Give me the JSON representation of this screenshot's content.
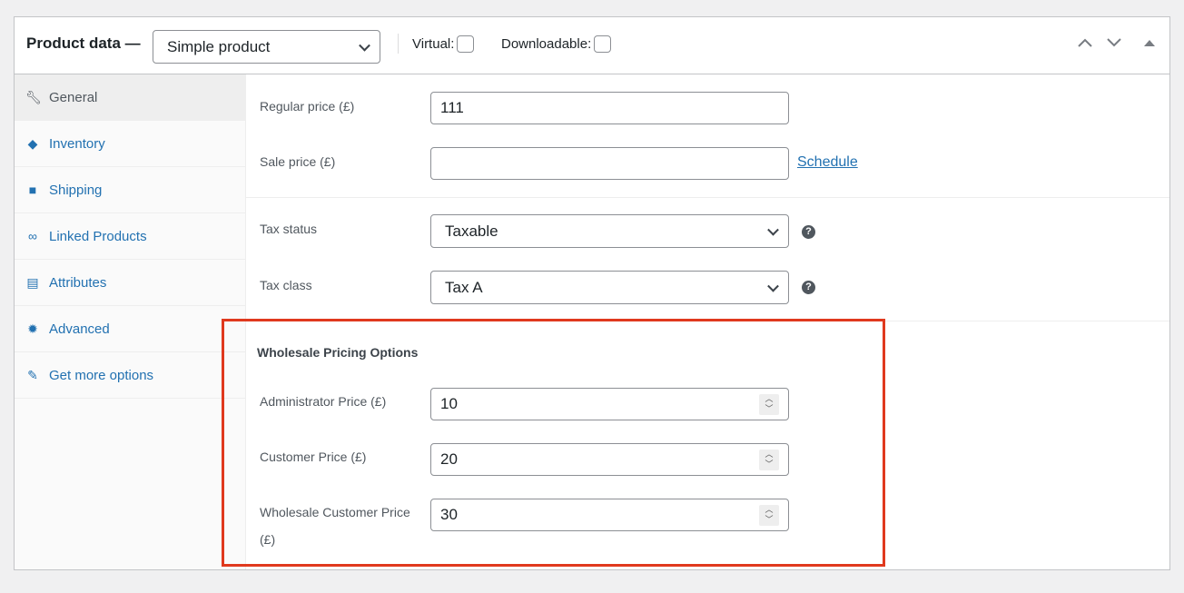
{
  "header": {
    "title": "Product data —",
    "product_type": "Simple product",
    "virtual_label": "Virtual:",
    "downloadable_label": "Downloadable:"
  },
  "sidebar": {
    "items": [
      {
        "label": "General",
        "icon": "wrench-icon",
        "active": true
      },
      {
        "label": "Inventory",
        "icon": "tag-icon"
      },
      {
        "label": "Shipping",
        "icon": "truck-icon"
      },
      {
        "label": "Linked Products",
        "icon": "link-icon"
      },
      {
        "label": "Attributes",
        "icon": "list-icon"
      },
      {
        "label": "Advanced",
        "icon": "gear-icon"
      },
      {
        "label": "Get more options",
        "icon": "plug-icon"
      }
    ]
  },
  "general": {
    "regular_price_label": "Regular price (£)",
    "regular_price": "111",
    "sale_price_label": "Sale price (£)",
    "sale_price": "",
    "schedule_link": "Schedule",
    "tax_status_label": "Tax status",
    "tax_status": "Taxable",
    "tax_class_label": "Tax class",
    "tax_class": "Tax A"
  },
  "wholesale": {
    "heading": "Wholesale Pricing Options",
    "fields": [
      {
        "label": "Administrator Price (£)",
        "value": "10"
      },
      {
        "label": "Customer Price (£)",
        "value": "20"
      },
      {
        "label": "Wholesale Customer Price",
        "label2": "(£)",
        "value": "30"
      }
    ]
  },
  "colors": {
    "highlight": "#e0391e",
    "link": "#2271b1"
  }
}
